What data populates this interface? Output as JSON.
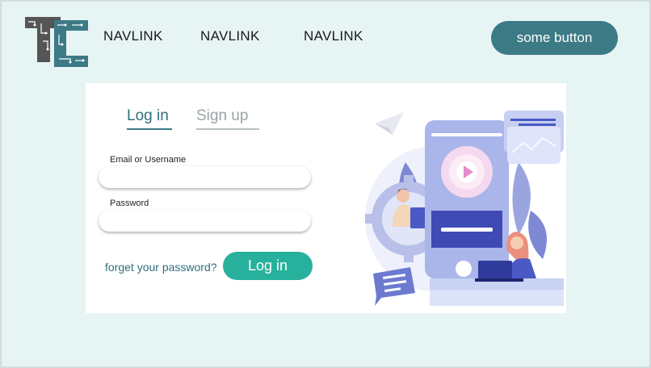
{
  "header": {
    "logo_icon": "tc-circuit-logo",
    "nav_links": [
      "NAVLINK",
      "NAVLINK",
      "NAVLINK"
    ],
    "button_label": "some button"
  },
  "card": {
    "tabs": [
      {
        "label": "Log in",
        "active": true
      },
      {
        "label": "Sign up",
        "active": false
      }
    ],
    "fields": {
      "username_label": "Email or Username",
      "username_value": "",
      "password_label": "Password",
      "password_value": ""
    },
    "forgot_link": "forget your password?",
    "login_button": "Log in",
    "illustration_icon": "mobile-app-login-illustration"
  },
  "colors": {
    "page_bg": "#e6f4f3",
    "header_button": "#3c7a86",
    "login_button": "#27b19c",
    "active_tab": "#2f6f7e",
    "illustration_accent": "#4a59c4"
  }
}
